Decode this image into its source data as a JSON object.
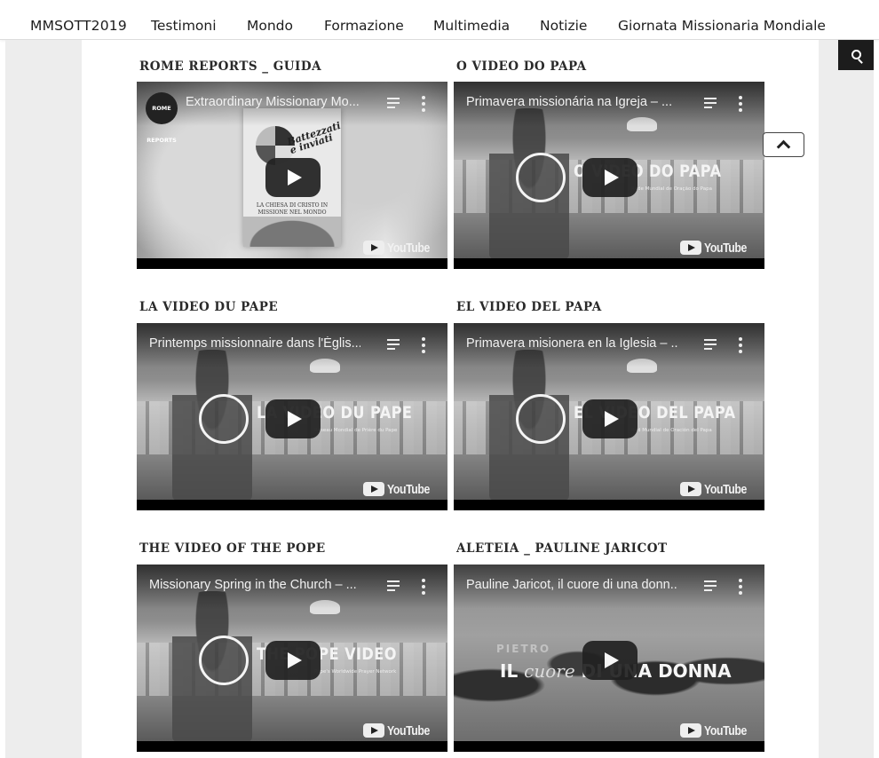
{
  "nav": {
    "brand": "MMSOTT2019",
    "items": [
      "Testimoni",
      "Mondo",
      "Formazione",
      "Multimedia",
      "Notizie",
      "Giornata Missionaria Mondiale"
    ]
  },
  "sections": [
    {
      "heading": "ROME REPORTS _ GUIDA",
      "video_title": "Extraordinary Missionary Mo...",
      "channel": "ROME REPORTS",
      "cover_title": "Battezzati e inviati",
      "cover_caption": "LA CHIESA DI CRISTO IN MISSIONE NEL MONDO",
      "youtube": "YouTube"
    },
    {
      "heading": "O VIDEO DO PAPA",
      "video_title": "Primavera missionária na Igreja – ...",
      "overlay": "O VIDEO DO PAPA",
      "overlay_sub": "Rede Mundial de Oração do Papa",
      "youtube": "YouTube"
    },
    {
      "heading": "LA VIDEO DU PAPE",
      "video_title": "Printemps missionnaire dans l'Églis...",
      "overlay": "LA VIDEO DU PAPE",
      "overlay_sub": "Réseau Mondial de Prière du Pape",
      "youtube": "YouTube"
    },
    {
      "heading": "EL VIDEO DEL PAPA",
      "video_title": "Primavera misionera en la Iglesia – ...",
      "overlay": "EL VIDEO DEL PAPA",
      "overlay_sub": "Red Mundial de Oración del Papa",
      "youtube": "YouTube"
    },
    {
      "heading": "THE VIDEO OF THE POPE",
      "video_title": "Missionary Spring in the Church – ...",
      "overlay": "THE POPE VIDEO",
      "overlay_sub": "Pope's Worldwide Prayer Network",
      "youtube": "YouTube"
    },
    {
      "heading": "ALETEIA _ PAULINE JARICOT",
      "video_title": "Pauline Jaricot, il cuore di una donn...",
      "overlay_top": "PIETRO",
      "overlay_a": "IL",
      "overlay_b": "cuore",
      "overlay_c": "DI UNA DONNA",
      "youtube": "YouTube"
    }
  ]
}
